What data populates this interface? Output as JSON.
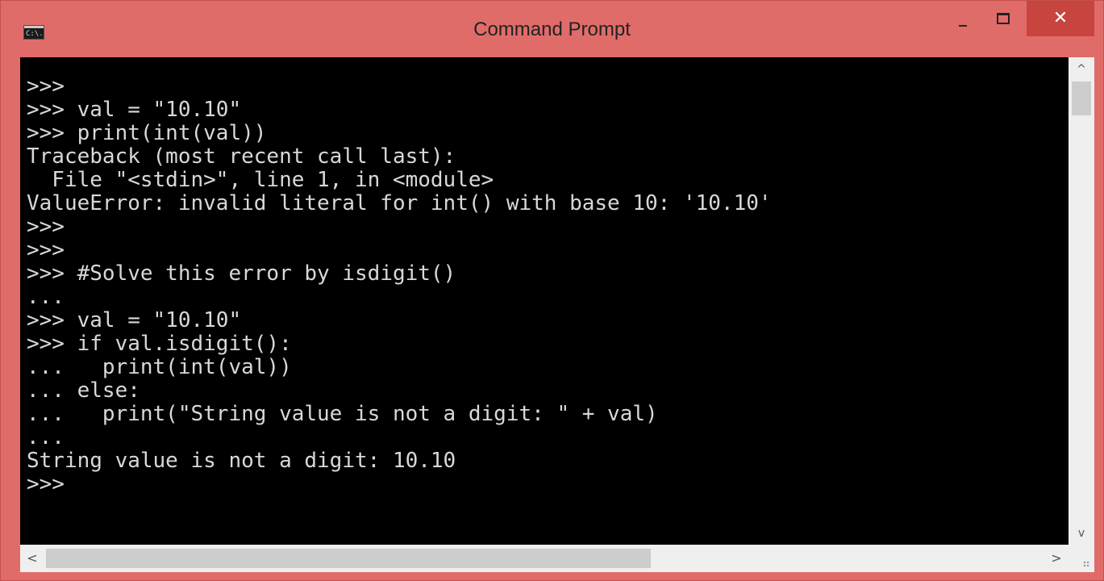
{
  "window": {
    "title": "Command Prompt",
    "icon_label": "C:\\.",
    "close_glyph": "✕",
    "accent_color": "#e06c6a"
  },
  "console": {
    "lines": [
      ">>>",
      ">>> val = \"10.10\"",
      ">>> print(int(val))",
      "Traceback (most recent call last):",
      "  File \"<stdin>\", line 1, in <module>",
      "ValueError: invalid literal for int() with base 10: '10.10'",
      ">>>",
      ">>>",
      ">>> #Solve this error by isdigit()",
      "...",
      ">>> val = \"10.10\"",
      ">>> if val.isdigit():",
      "...   print(int(val))",
      "... else:",
      "...   print(\"String value is not a digit: \" + val)",
      "...",
      "String value is not a digit: 10.10",
      ">>>"
    ]
  },
  "scrollbars": {
    "up_glyph": "^",
    "down_glyph": "v",
    "left_glyph": "<",
    "right_glyph": ">"
  }
}
